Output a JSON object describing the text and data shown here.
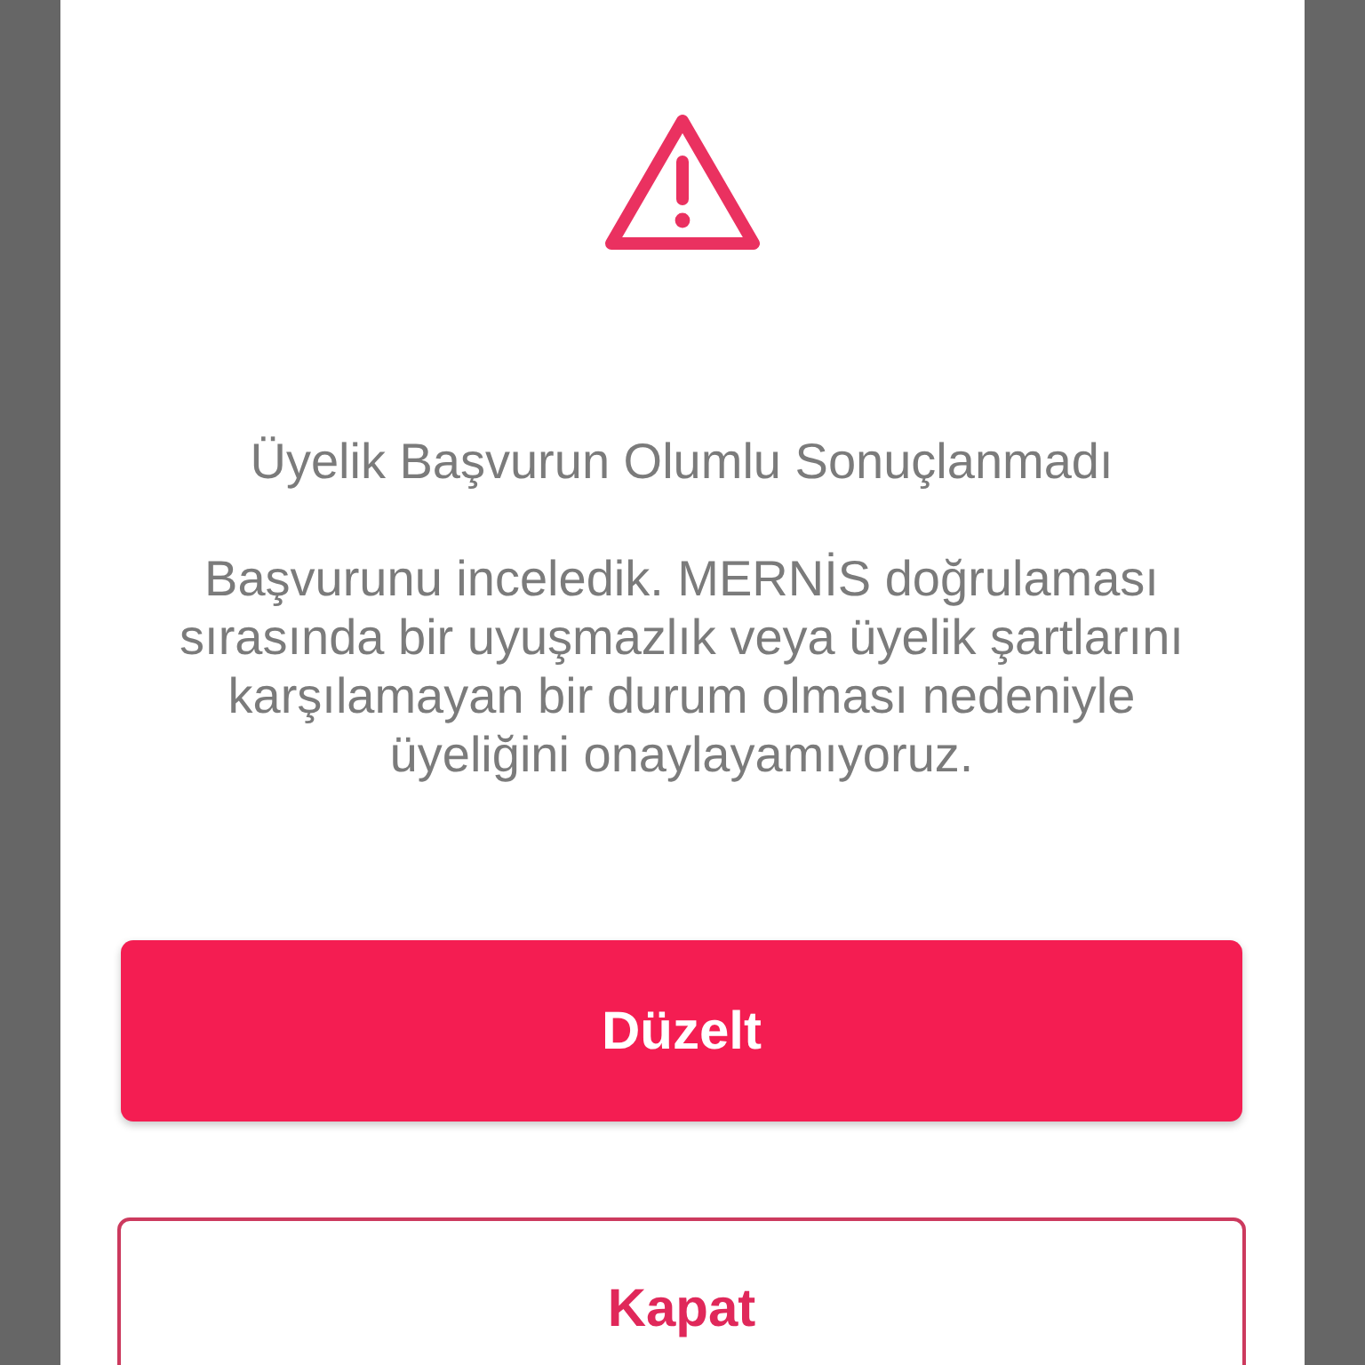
{
  "dialog": {
    "title": "Üyelik Başvurun Olumlu Sonuçlanmadı",
    "message": "Başvurunu inceledik. MERNİS doğrulaması sırasında bir uyuşmazlık veya üyelik şartlarını karşılamayan bir durum olması nedeniyle üyeliğini onaylayamıyoruz.",
    "buttons": [
      {
        "label": "Düzelt",
        "kind": "primary"
      },
      {
        "label": "Kapat",
        "kind": "outline"
      }
    ]
  }
}
